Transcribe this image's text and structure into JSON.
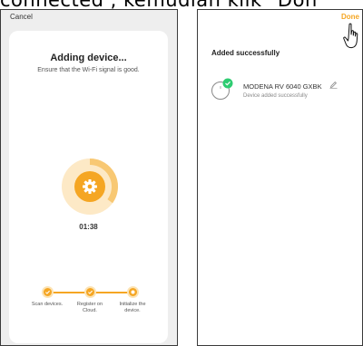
{
  "caption": "connected , kemudian klik \"Don",
  "left_screen": {
    "cancel_label": "Cancel",
    "title": "Adding device...",
    "subtitle": "Ensure that the Wi-Fi signal is good.",
    "timer": "01:38",
    "progress": 0.35,
    "steps": [
      {
        "label": "Scan devices.",
        "state": "done"
      },
      {
        "label": "Register on Cloud.",
        "state": "done"
      },
      {
        "label": "Initialize the device.",
        "state": "in-progress"
      }
    ]
  },
  "right_screen": {
    "done_label": "Done",
    "success_title": "Added successfully",
    "device": {
      "name": "MODENA RV 6040 GXBK",
      "status": "Device added successfully"
    }
  },
  "colors": {
    "accent": "#f5a623",
    "success": "#2ecc71",
    "card": "#ffffff",
    "screen_bg": "#eeeeee"
  },
  "icons": [
    "gear-icon",
    "check-icon",
    "edit-icon",
    "pointer-hand-icon",
    "device-icon"
  ]
}
